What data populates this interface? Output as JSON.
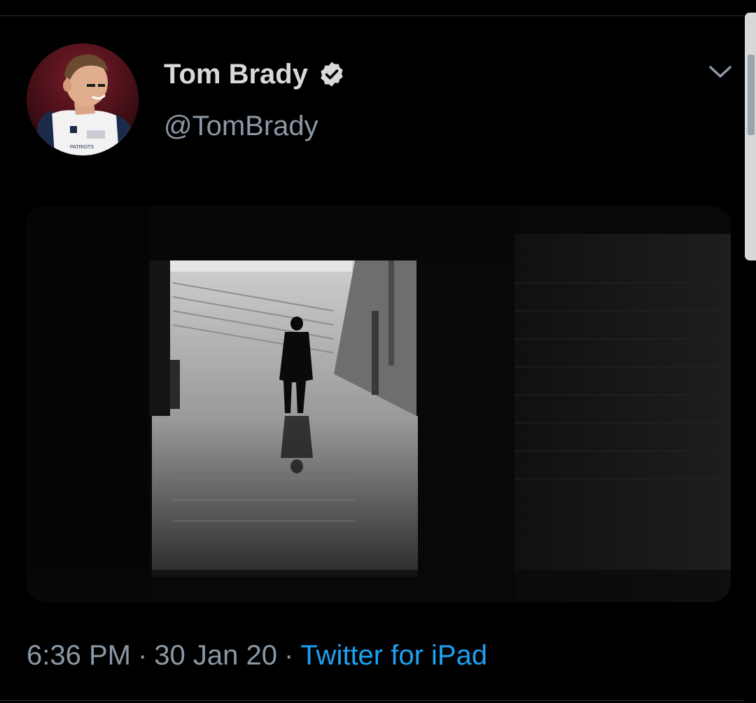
{
  "tweet": {
    "author": {
      "display_name": "Tom Brady",
      "handle": "@TomBrady",
      "verified": true,
      "verified_icon": "verified-badge-icon"
    },
    "menu_icon": "chevron-down-icon",
    "media": {
      "kind": "photo",
      "scene": "silhouette-in-stadium-tunnel"
    },
    "meta": {
      "time": "6:36 PM",
      "separator": "·",
      "date": "30 Jan 20",
      "source": "Twitter for iPad"
    }
  },
  "colors": {
    "background": "#000000",
    "name_text": "#d9d9d9",
    "secondary_text": "#8b98a5",
    "link": "#1da1f2",
    "divider": "#2f3336"
  }
}
